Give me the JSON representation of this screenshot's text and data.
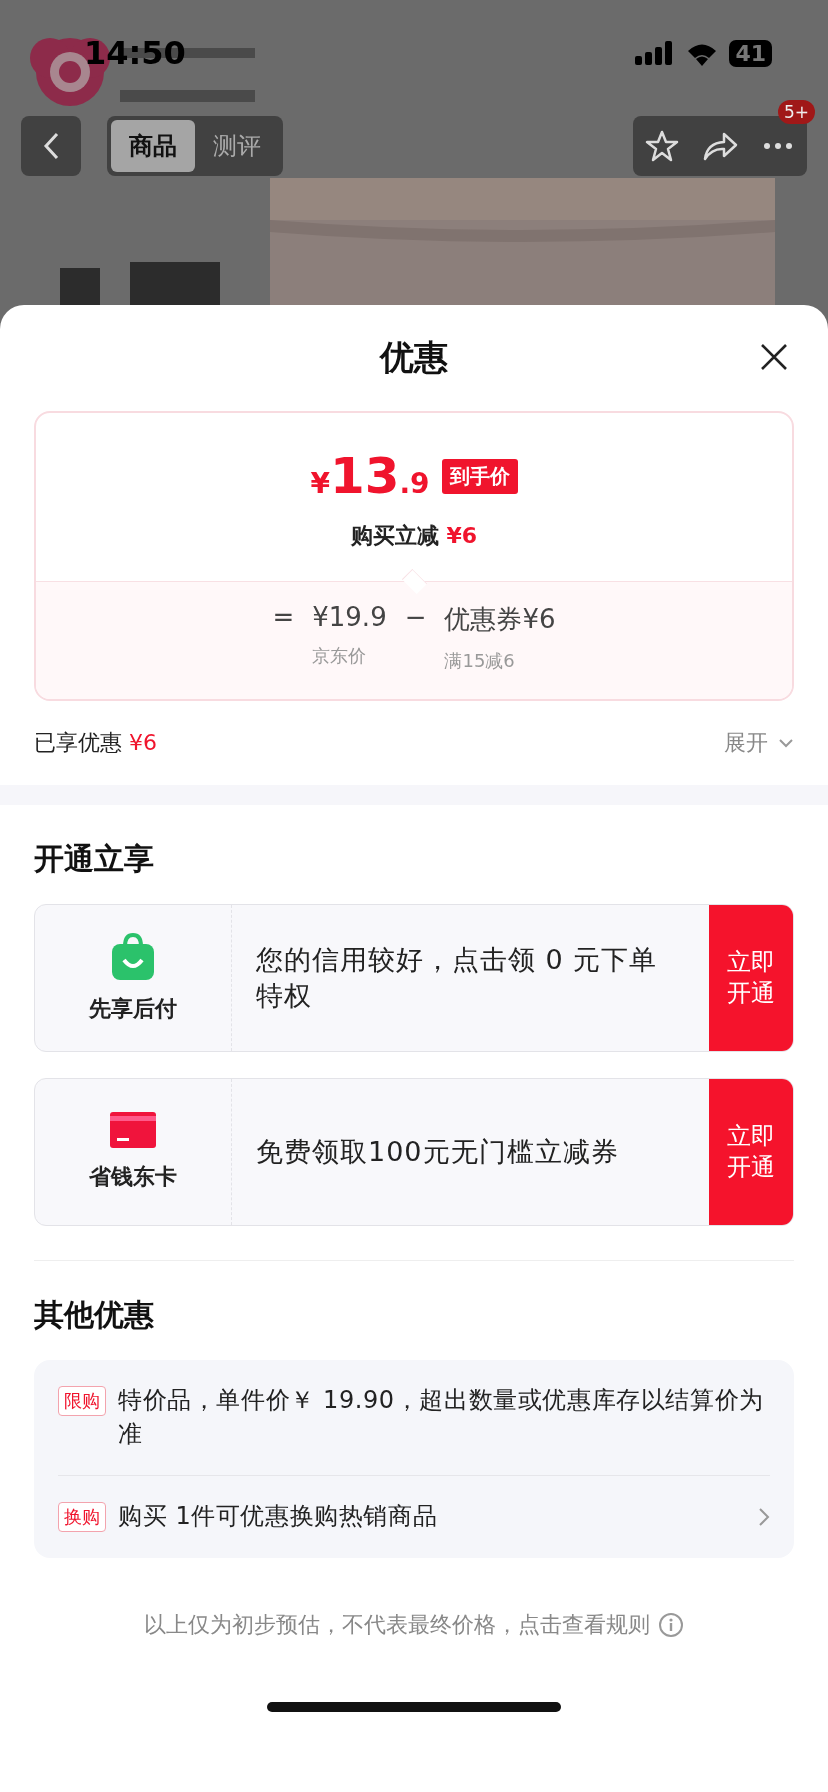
{
  "status_bar": {
    "time": "14:50",
    "battery": "41"
  },
  "nav": {
    "tabs": [
      {
        "label": "商品",
        "selected": true
      },
      {
        "label": "测评",
        "selected": false
      }
    ],
    "badge": "5+"
  },
  "sheet": {
    "title": "优惠",
    "price_card": {
      "currency": "¥",
      "integer": "13",
      "decimal": ".9",
      "tag": "到手价",
      "reduction_label": "购买立减",
      "reduction_amount": "¥6",
      "formula": {
        "equals": "=",
        "base_price": "¥19.9",
        "minus": "−",
        "coupon": "优惠券¥6",
        "base_caption": "京东价",
        "coupon_caption": "满15减6"
      }
    },
    "savings": {
      "label": "已享优惠",
      "amount": "¥6",
      "expand": "展开"
    },
    "open_section": {
      "title": "开通立享",
      "offers": [
        {
          "kind": "bag",
          "name": "先享后付",
          "description": "您的信用较好，点击领 0 元下单特权",
          "button": "立即开通"
        },
        {
          "kind": "card",
          "name": "省钱东卡",
          "description": "免费领取100元无门槛立减券",
          "button": "立即开通"
        }
      ]
    },
    "other_section": {
      "title": "其他优惠",
      "items": [
        {
          "tag": "限购",
          "text": "特价品，单件价￥ 19.90，超出数量或优惠库存以结算价为准",
          "has_arrow": false
        },
        {
          "tag": "换购",
          "text": "购买 1件可优惠换购热销商品",
          "has_arrow": true
        }
      ]
    },
    "footer": "以上仅为初步预估，不代表最终价格，点击查看规则"
  }
}
